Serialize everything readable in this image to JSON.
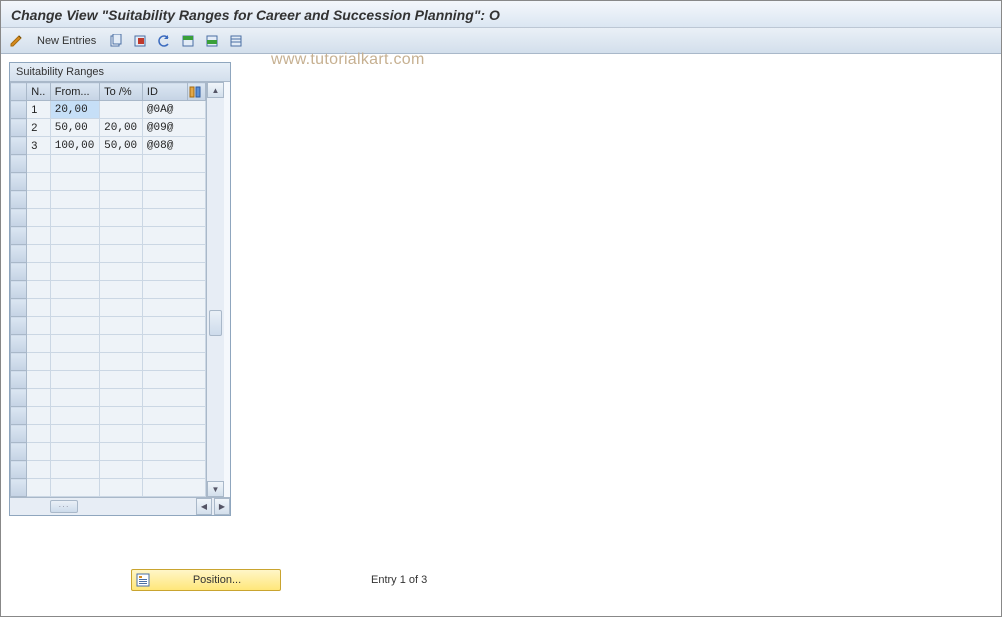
{
  "title": "Change View \"Suitability Ranges for Career and Succession Planning\": O",
  "toolbar": {
    "new_entries_label": "New Entries"
  },
  "watermark": "www.tutorialkart.com",
  "panel": {
    "title": "Suitability Ranges",
    "columns": {
      "n": "N..",
      "from": "From...",
      "to": "To /%",
      "id": "ID"
    },
    "rows": [
      {
        "n": "1",
        "from": "20,00",
        "to": "",
        "id": "@0A@",
        "selected": true
      },
      {
        "n": "2",
        "from": "50,00",
        "to": "20,00",
        "id": "@09@",
        "selected": false
      },
      {
        "n": "3",
        "from": "100,00",
        "to": "50,00",
        "id": "@08@",
        "selected": false
      }
    ],
    "empty_rows": 19
  },
  "footer": {
    "position_label": "Position...",
    "entry_text": "Entry 1 of 3"
  }
}
